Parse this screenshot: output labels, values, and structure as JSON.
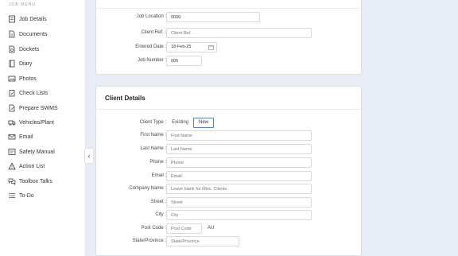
{
  "sidebar": {
    "title": "JOB MENU",
    "items": [
      {
        "label": "Job Details",
        "icon": "job-details-icon"
      },
      {
        "label": "Documents",
        "icon": "documents-icon"
      },
      {
        "label": "Dockets",
        "icon": "dockets-icon"
      },
      {
        "label": "Diary",
        "icon": "diary-icon"
      },
      {
        "label": "Photos",
        "icon": "photos-icon"
      },
      {
        "label": "Check Lists",
        "icon": "checklist-icon"
      },
      {
        "label": "Prepare SWMS",
        "icon": "swms-icon"
      },
      {
        "label": "Vehicles/Plant",
        "icon": "truck-icon"
      },
      {
        "label": "Email",
        "icon": "email-icon"
      },
      {
        "label": "Safety Manual",
        "icon": "safety-manual-icon"
      },
      {
        "label": "Action List",
        "icon": "warning-icon"
      },
      {
        "label": "Toolbox Talks",
        "icon": "chat-icon"
      },
      {
        "label": "To-Do",
        "icon": "todo-icon"
      }
    ],
    "collapse_glyph": "‹"
  },
  "job": {
    "job_location_label": "Job Location :",
    "job_location_value": "0000",
    "client_ref_label": "Client Ref. :",
    "client_ref_placeholder": "Client Ref.",
    "entered_date_label": "Entered Date :",
    "entered_date_value": "18-Feb-25",
    "job_number_label": "Job Number :",
    "job_number_value": "005"
  },
  "client": {
    "title": "Client Details",
    "client_type_label": "Client Type :",
    "existing_label": "Existing",
    "new_label": "New",
    "first_name_label": "First Name :",
    "first_name_placeholder": "First Name",
    "last_name_label": "Last Name :",
    "last_name_placeholder": "Last Name",
    "phone_label": "Phone :",
    "phone_placeholder": "Phone",
    "email_label": "Email :",
    "email_placeholder": "Email",
    "company_label": "Company Name :",
    "company_placeholder": "Leave blank for Misc. Clients",
    "street_label": "Street :",
    "street_placeholder": "Street",
    "city_label": "City :",
    "city_placeholder": "City",
    "postcode_label": "Post Code :",
    "postcode_placeholder": "Post Code",
    "country_value": "AU",
    "state_label": "State/Province :",
    "state_placeholder": "State/Province"
  },
  "colors": {
    "background": "#e8edf5",
    "accent_border": "#5a7fb6"
  }
}
